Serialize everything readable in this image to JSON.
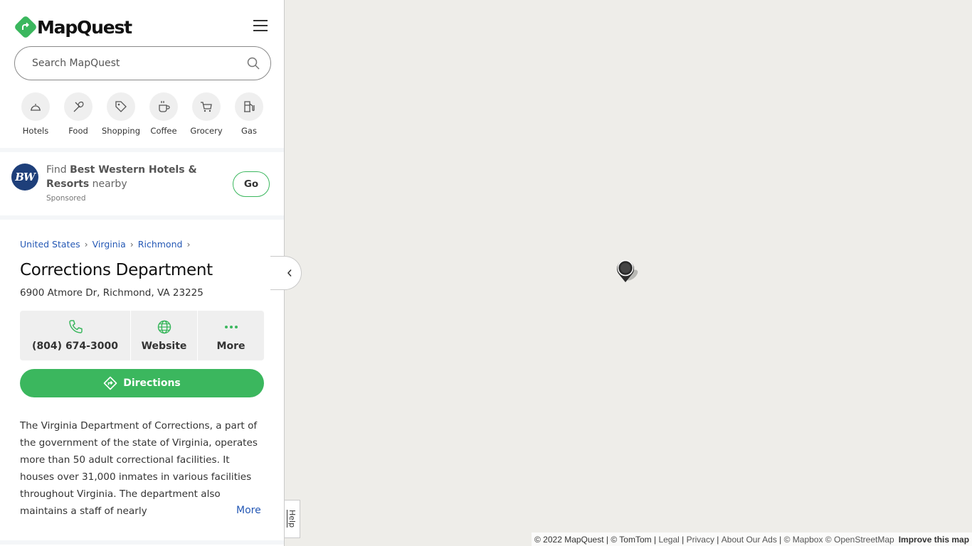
{
  "header": {
    "logo_text": "MapQuest",
    "menu_icon": "hamburger-icon"
  },
  "search": {
    "placeholder": "Search MapQuest",
    "value": "",
    "icon": "search-icon"
  },
  "categories": [
    {
      "label": "Hotels",
      "icon": "bell-icon"
    },
    {
      "label": "Food",
      "icon": "utensils-icon"
    },
    {
      "label": "Shopping",
      "icon": "tag-icon"
    },
    {
      "label": "Coffee",
      "icon": "coffee-cup-icon"
    },
    {
      "label": "Grocery",
      "icon": "cart-icon"
    },
    {
      "label": "Gas",
      "icon": "gas-pump-icon"
    }
  ],
  "ad": {
    "logo_text": "BW",
    "find": "Find",
    "brand": "Best Western Hotels & Resorts",
    "nearby": "nearby",
    "sponsored": "Sponsored",
    "go_label": "Go"
  },
  "breadcrumb": [
    "United States",
    "Virginia",
    "Richmond"
  ],
  "place": {
    "name": "Corrections Department",
    "address": "6900 Atmore Dr, Richmond, VA 23225",
    "phone": "(804) 674-3000",
    "website_label": "Website",
    "more_label": "More",
    "directions_label": "Directions",
    "description": "The Virginia Department of Corrections, a part of the government of the state of Virginia, operates more than 50 adult correctional facilities. It houses over 31,000 inmates in various facilities throughout Virginia. The department also maintains a staff of nearly",
    "description_more": "More"
  },
  "help_label": "Help",
  "attribution": {
    "copyright": "© 2022 MapQuest | © TomTom |",
    "legal": "Legal",
    "privacy": "Privacy",
    "ads": "About Our Ads",
    "mapbox": "© Mapbox © OpenStreetMap",
    "improve": "Improve this map"
  },
  "colors": {
    "accent": "#3bb75e",
    "link": "#2458b5",
    "map_bg": "#eeede9"
  }
}
